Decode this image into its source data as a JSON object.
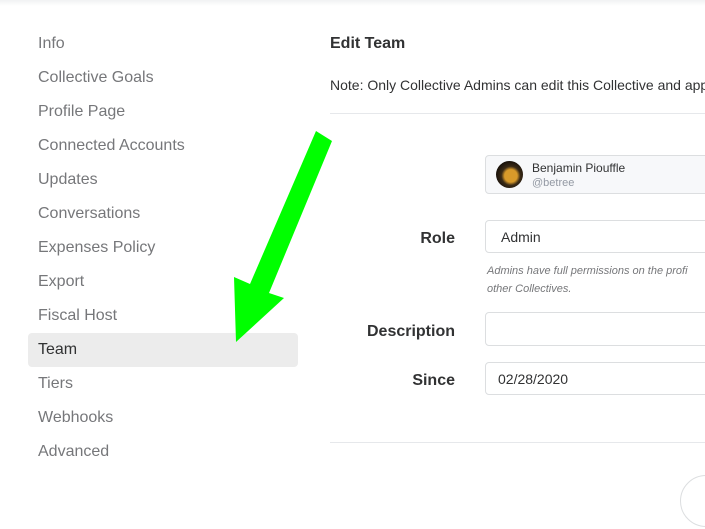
{
  "sidebar": {
    "items": [
      {
        "label": "Info"
      },
      {
        "label": "Collective Goals"
      },
      {
        "label": "Profile Page"
      },
      {
        "label": "Connected Accounts"
      },
      {
        "label": "Updates"
      },
      {
        "label": "Conversations"
      },
      {
        "label": "Expenses Policy"
      },
      {
        "label": "Export"
      },
      {
        "label": "Fiscal Host"
      },
      {
        "label": "Team"
      },
      {
        "label": "Tiers"
      },
      {
        "label": "Webhooks"
      },
      {
        "label": "Advanced"
      }
    ],
    "active": "Team"
  },
  "main": {
    "title": "Edit Team",
    "note": "Note: Only Collective Admins can edit this Collective and app"
  },
  "member": {
    "name": "Benjamin Piouffle",
    "handle": "@betree"
  },
  "form": {
    "role_label": "Role",
    "role_value": "Admin",
    "role_help_line1": "Admins have full permissions on the profi",
    "role_help_line2": "other Collectives.",
    "description_label": "Description",
    "description_value": "",
    "since_label": "Since",
    "since_value": "02/28/2020"
  },
  "annotation": {
    "arrow_color": "#00ff00",
    "arrow_target": "Team"
  }
}
